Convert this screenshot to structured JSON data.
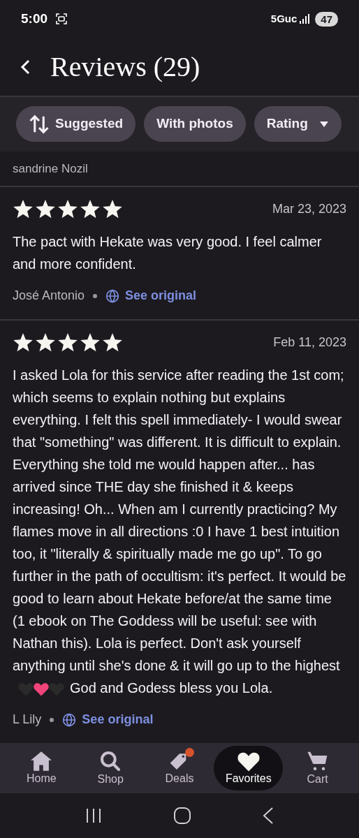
{
  "status_bar": {
    "time": "5:00",
    "network": "5Guc",
    "battery": "47"
  },
  "header": {
    "title": "Reviews (29)"
  },
  "filters": [
    {
      "label": "Suggested",
      "kind": "sort"
    },
    {
      "label": "With photos",
      "kind": "plain"
    },
    {
      "label": "Rating",
      "kind": "dropdown"
    }
  ],
  "previous_reviewer": "sandrine Nozil",
  "reviews": [
    {
      "stars": 5,
      "date": "Mar 23, 2023",
      "body": "The pact with Hekate was very good. I feel calmer and more confident.",
      "author": "José Antonio",
      "translate_link": "See original"
    },
    {
      "stars": 5,
      "date": "Feb 11, 2023",
      "body": "I asked Lola for this service after reading the 1st com; which seems to explain nothing but explains everything. I felt this spell immediately- I would swear that \"something\" was different.  It is difficult to explain. Everything she told me would happen after... has arrived since THE day she finished it & keeps increasing! Oh... When am I currently practicing? My flames move in all directions :0 I have 1 best intuition too, it \"literally & spiritually made me go up\".  To go further in the path of occultism: it's perfect. It would be good to learn about Hekate before/at the same time (1 ebook on The Goddess will be useful: see with Nathan this). Lola is perfect. Don't ask yourself anything until she's done & it will go up to the highest",
      "hearts": [
        {
          "color": "#2a2a2a"
        },
        {
          "color": "#f0447a"
        },
        {
          "color": "#2a2a2a"
        }
      ],
      "body_after": "God and Godess bless you Lola.",
      "author": "L Lily",
      "translate_link": "See original"
    }
  ],
  "nav": [
    {
      "label": "Home",
      "kind": "home",
      "selected": false,
      "badge": false
    },
    {
      "label": "Shop",
      "kind": "search",
      "selected": false,
      "badge": false
    },
    {
      "label": "Deals",
      "kind": "tag",
      "selected": false,
      "badge": true
    },
    {
      "label": "Favorites",
      "kind": "heart",
      "selected": true,
      "badge": false
    },
    {
      "label": "Cart",
      "kind": "cart",
      "selected": false,
      "badge": false
    }
  ]
}
